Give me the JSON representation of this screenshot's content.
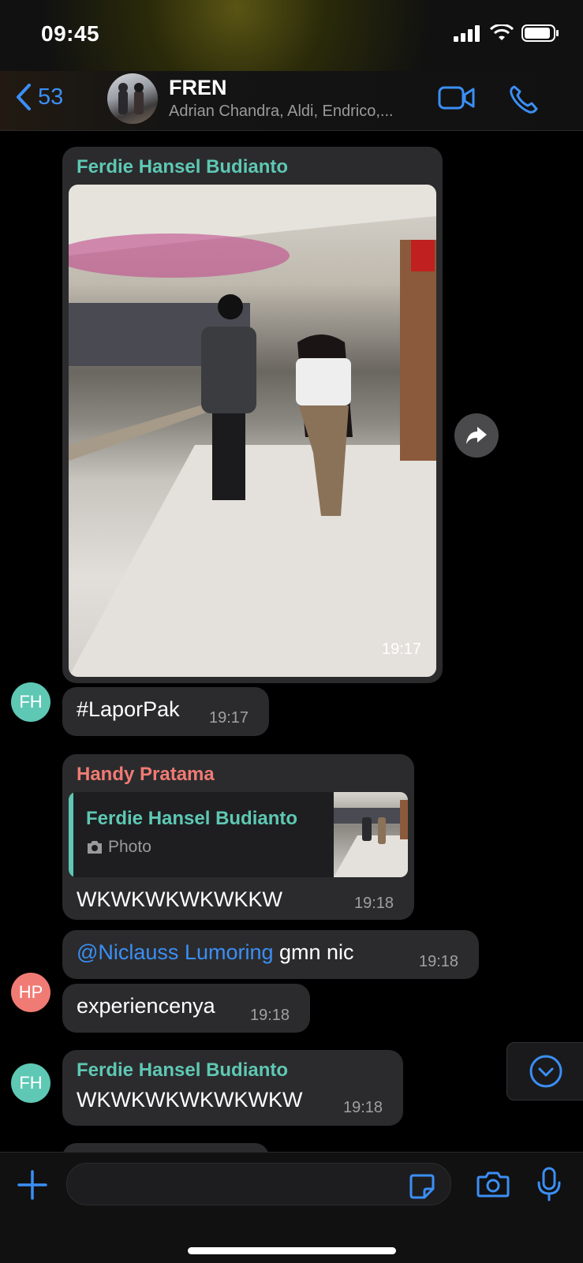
{
  "status_bar": {
    "time": "09:45",
    "icons": [
      "signal-icon",
      "wifi-icon",
      "battery-icon"
    ]
  },
  "header": {
    "back_count": "53",
    "title": "FREN",
    "subtitle": "Adrian Chandra, Aldi, Endrico,...",
    "icons": [
      "back-chevron-icon",
      "video-call-icon",
      "phone-call-icon"
    ]
  },
  "messages": [
    {
      "sender": "Ferdie Hansel Budianto",
      "type": "photo",
      "time": "19:17"
    },
    {
      "avatar": "FH",
      "text": "#LaporPak",
      "time": "19:17"
    },
    {
      "sender": "Handy Pratama",
      "reply_to": {
        "sender": "Ferdie Hansel Budianto",
        "label": "Photo"
      },
      "text": "WKWKWKWKWKKW",
      "time": "19:18"
    },
    {
      "mention": "@Niclauss Lumoring",
      "text": " gmn nic",
      "time": "19:18"
    },
    {
      "avatar": "HP",
      "text": "experiencenya",
      "time": "19:18"
    },
    {
      "sender": "Ferdie Hansel Budianto",
      "avatar": "FH",
      "text": "WKWKWKWKWKWKW",
      "time": "19:18"
    }
  ],
  "colors": {
    "accent": "#3b8ff5",
    "teal_sender": "#5ec8b4",
    "red_sender": "#f07b74",
    "bubble": "#2b2b2d",
    "avatar_fh": "#5ec8b4",
    "avatar_hp": "#f07b74"
  },
  "input": {
    "placeholder": ""
  }
}
